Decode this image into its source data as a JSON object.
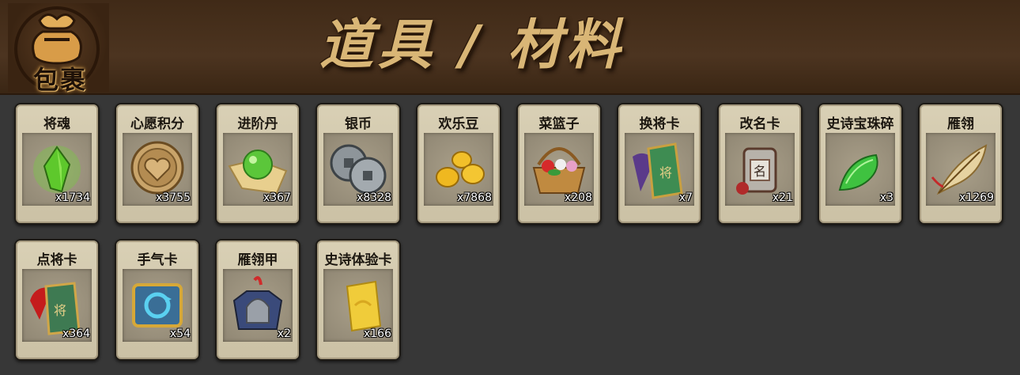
{
  "header": {
    "bag_label": "包裹",
    "title": "道具 / 材料"
  },
  "items": [
    {
      "name": "将魂",
      "count": "x1734",
      "icon": "green-crystal-icon"
    },
    {
      "name": "心愿积分",
      "count": "x3755",
      "icon": "heart-coin-icon"
    },
    {
      "name": "进阶丹",
      "count": "x367",
      "icon": "green-orb-icon"
    },
    {
      "name": "银币",
      "count": "x8328",
      "icon": "silver-coins-icon"
    },
    {
      "name": "欢乐豆",
      "count": "x7868",
      "icon": "golden-beans-icon"
    },
    {
      "name": "菜篮子",
      "count": "x208",
      "icon": "flower-basket-icon"
    },
    {
      "name": "换将卡",
      "count": "x7",
      "icon": "swap-general-card-icon"
    },
    {
      "name": "改名卡",
      "count": "x21",
      "icon": "rename-card-icon"
    },
    {
      "name": "史诗宝珠碎",
      "count": "x3",
      "icon": "green-shard-icon"
    },
    {
      "name": "雁翎",
      "count": "x1269",
      "icon": "feather-icon"
    },
    {
      "name": "点将卡",
      "count": "x364",
      "icon": "pick-general-card-icon"
    },
    {
      "name": "手气卡",
      "count": "x54",
      "icon": "luck-card-icon"
    },
    {
      "name": "雁翎甲",
      "count": "x2",
      "icon": "armor-icon"
    },
    {
      "name": "史诗体验卡",
      "count": "x166",
      "icon": "epic-trial-card-icon"
    }
  ]
}
